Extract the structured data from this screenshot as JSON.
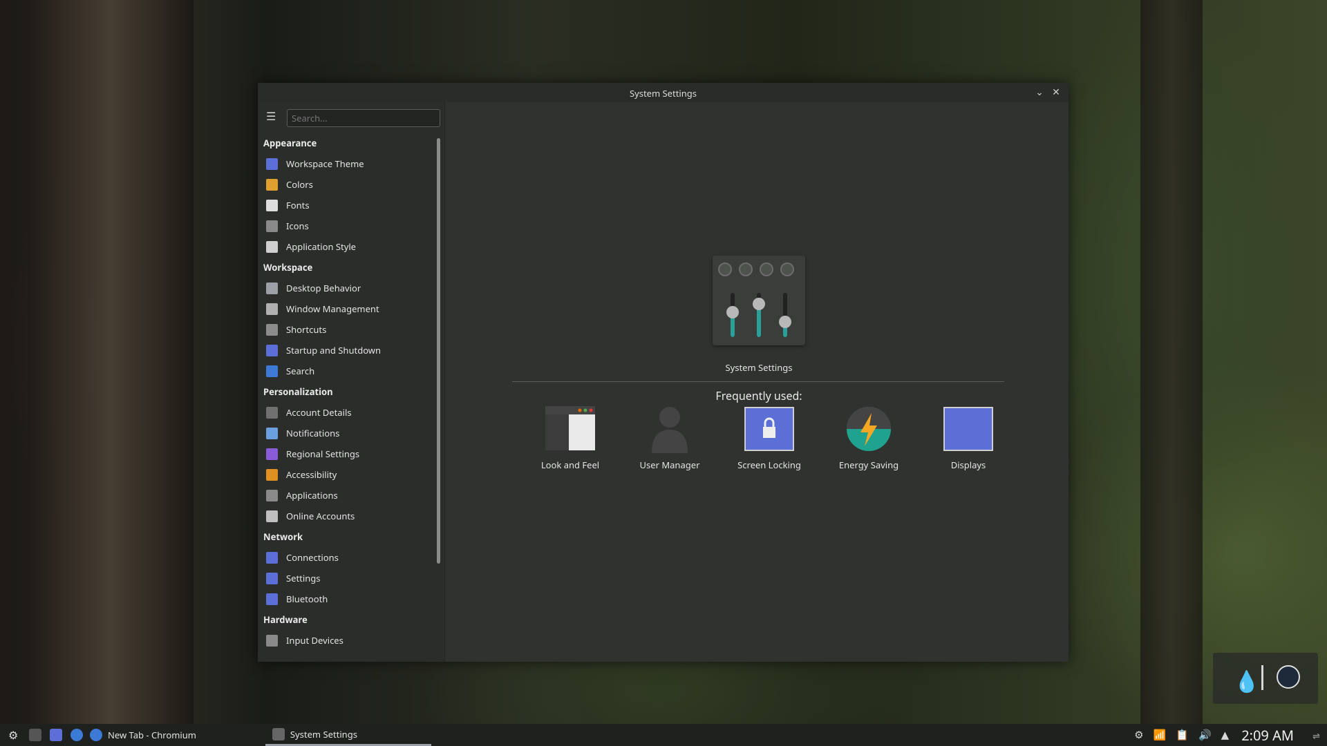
{
  "window": {
    "title": "System Settings",
    "minimize_glyph": "⌄",
    "close_glyph": "✕"
  },
  "search": {
    "placeholder": "Search..."
  },
  "sidebar": {
    "categories": [
      {
        "label": "Appearance",
        "items": [
          {
            "label": "Workspace Theme",
            "color": "#5b6fd6"
          },
          {
            "label": "Colors",
            "color": "#e0a030"
          },
          {
            "label": "Fonts",
            "color": "#dddddd"
          },
          {
            "label": "Icons",
            "color": "#8a8a8a"
          },
          {
            "label": "Application Style",
            "color": "#cfcfcf"
          }
        ]
      },
      {
        "label": "Workspace",
        "items": [
          {
            "label": "Desktop Behavior",
            "color": "#9aa0a6"
          },
          {
            "label": "Window Management",
            "color": "#b0b0b0"
          },
          {
            "label": "Shortcuts",
            "color": "#8c8c8c"
          },
          {
            "label": "Startup and Shutdown",
            "color": "#5b6fd6"
          },
          {
            "label": "Search",
            "color": "#3d7ad6"
          }
        ]
      },
      {
        "label": "Personalization",
        "items": [
          {
            "label": "Account Details",
            "color": "#707070"
          },
          {
            "label": "Notifications",
            "color": "#6aa0e0"
          },
          {
            "label": "Regional Settings",
            "color": "#8a5bd6"
          },
          {
            "label": "Accessibility",
            "color": "#e09020"
          },
          {
            "label": "Applications",
            "color": "#8a8a8a"
          },
          {
            "label": "Online Accounts",
            "color": "#bfbfbf"
          }
        ]
      },
      {
        "label": "Network",
        "items": [
          {
            "label": "Connections",
            "color": "#5b6fd6"
          },
          {
            "label": "Settings",
            "color": "#5b6fd6"
          },
          {
            "label": "Bluetooth",
            "color": "#5b6fd6"
          }
        ]
      },
      {
        "label": "Hardware",
        "items": [
          {
            "label": "Input Devices",
            "color": "#8a8a8a"
          }
        ]
      }
    ]
  },
  "main": {
    "hero_label": "System Settings",
    "frequently_used_label": "Frequently used:",
    "tiles": [
      {
        "label": "Look and Feel",
        "icon": "look-and-feel-icon"
      },
      {
        "label": "User Manager",
        "icon": "user-manager-icon"
      },
      {
        "label": "Screen Locking",
        "icon": "screen-locking-icon"
      },
      {
        "label": "Energy Saving",
        "icon": "energy-saving-icon"
      },
      {
        "label": "Displays",
        "icon": "displays-icon"
      }
    ]
  },
  "taskbar": {
    "tasks": [
      {
        "label": "New Tab - Chromium"
      },
      {
        "label": "System Settings"
      }
    ],
    "clock": "2:09 AM"
  },
  "colors": {
    "accent": "#2aa198",
    "tile_blue": "#5b6fd6",
    "window_bg": "#303230"
  }
}
